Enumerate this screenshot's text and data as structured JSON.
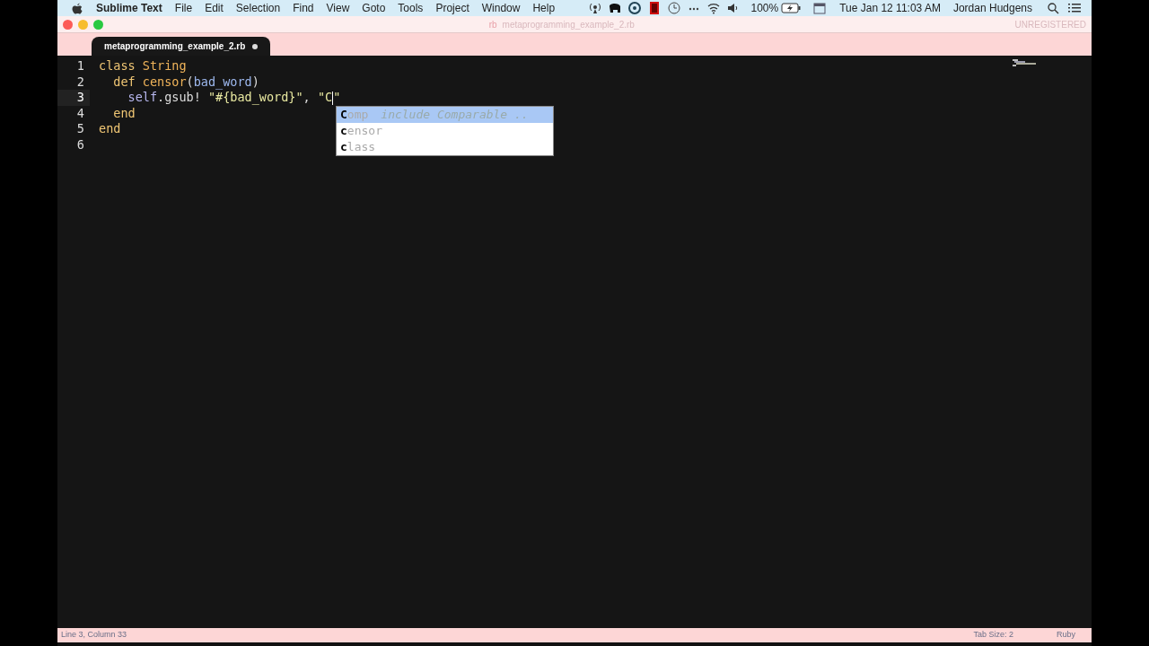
{
  "menu_bar": {
    "app": "Sublime Text",
    "menus": [
      "File",
      "Edit",
      "Selection",
      "Find",
      "View",
      "Goto",
      "Tools",
      "Project",
      "Window",
      "Help"
    ],
    "battery": "100%",
    "clock": "Tue Jan 12  11:03 AM",
    "user": "Jordan Hudgens"
  },
  "window": {
    "title": "metaprogramming_example_2.rb",
    "title_prefix": "rb",
    "registration": "UNREGISTERED"
  },
  "tabs": [
    {
      "label": "metaprogramming_example_2.rb",
      "selected": true,
      "modified": true
    }
  ],
  "lines": [
    {
      "number": "1",
      "current": false,
      "tokens": [
        {
          "kind": "keyword",
          "text": "class "
        },
        {
          "kind": "type",
          "text": "String"
        }
      ]
    },
    {
      "number": "2",
      "current": false,
      "tokens": [
        {
          "kind": "keyword",
          "text": "  def "
        },
        {
          "kind": "function",
          "text": "censor"
        },
        {
          "kind": "plain",
          "text": "("
        },
        {
          "kind": "param",
          "text": "bad_word"
        },
        {
          "kind": "plain",
          "text": ")"
        }
      ]
    },
    {
      "number": "3",
      "current": true,
      "tokens": [
        {
          "kind": "self",
          "text": "    self"
        },
        {
          "kind": "plain",
          "text": ".gsub! "
        },
        {
          "kind": "string",
          "text": "\"#{bad_word}\""
        },
        {
          "kind": "plain",
          "text": ", "
        },
        {
          "kind": "string",
          "text": "\"C",
          "cursor_after": true
        },
        {
          "kind": "string",
          "text": "\""
        }
      ]
    },
    {
      "number": "4",
      "current": false,
      "tokens": [
        {
          "kind": "keyword",
          "text": "  end"
        }
      ]
    },
    {
      "number": "5",
      "current": false,
      "tokens": [
        {
          "kind": "keyword",
          "text": "end"
        }
      ]
    },
    {
      "number": "6",
      "current": false
    }
  ],
  "autocomplete": [
    {
      "match": "C",
      "rest": "omp",
      "hint": "include Comparable ..",
      "selected": true
    },
    {
      "match": "c",
      "rest": "ensor",
      "selected": false
    },
    {
      "match": "c",
      "rest": "lass",
      "selected": false
    }
  ],
  "status_bar": {
    "position": "Line 3, Column 33",
    "tab_size": "Tab Size: 2",
    "syntax": "Ruby"
  }
}
